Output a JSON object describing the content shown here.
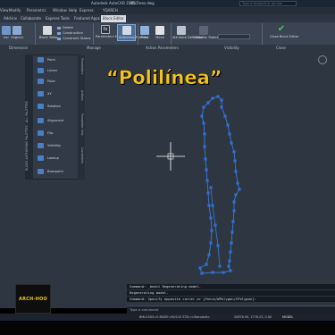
{
  "titlebar": {
    "app_title": "Autodesk AutoCAD 2025",
    "file_name": "MisTrees.dwg",
    "search_placeholder": "Type a keyword or phrase"
  },
  "menus": [
    "View",
    "Modify",
    "Parametric",
    "Window",
    "Help",
    "Express",
    "YQARCH"
  ],
  "tabs": [
    {
      "label": "Add-ins",
      "active": false
    },
    {
      "label": "Collaborate",
      "active": false
    },
    {
      "label": "Express Tools",
      "active": false
    },
    {
      "label": "Featured Apps",
      "active": false
    },
    {
      "label": "Block Editor",
      "active": true
    }
  ],
  "ribbon": {
    "dimension": {
      "btn1": "ear",
      "btn2": "Aligned"
    },
    "block_table": "Block Table",
    "delete": "Delete",
    "construction": "Construction",
    "constraint_status": "Constraint Status",
    "parameters_manager": "Parameters Manager",
    "authoring_palettes": "Authoring Palettes",
    "point": "Point",
    "move": "Move",
    "attribute_definition": "Attribute Definition",
    "visibility_states": "Visibility States",
    "visibility_box": "",
    "close_block_editor": "Close Block Editor"
  },
  "ribbon_panels": {
    "dimension": "Dimension",
    "manage": "Manage",
    "action_parameters": "Action Parameters",
    "visibility": "Visibility",
    "close": "Close"
  },
  "palette": {
    "title": "BLOCK AUTHORING PALETTES - ALL PALETTES",
    "tabs": [
      "Parameters",
      "Actions",
      "Parameter Sets",
      "Constraints"
    ],
    "items": [
      "Point",
      "Linear",
      "Polar",
      "XY",
      "Rotation",
      "Alignment",
      "Flip",
      "Visibility",
      "Lookup",
      "Basepoint"
    ]
  },
  "caption": "“Polilínea”",
  "figure": {
    "stroke_color": "#3e7bd6",
    "grip_color": "#2f6fd8"
  },
  "command": {
    "history": [
      "Command: _bedit Regenerating model.",
      "Regenerating model.",
      "Command: Specify opposite corner or [Fence/WPolygon/CPolygon]:"
    ],
    "prompt": "Type a command"
  },
  "logo_text": "ARCH-HOO",
  "status": {
    "left": "BMLOCKS=0  BSIZE=90/110  STD=<Standard>",
    "coords": "20876.90, 1778.23, 0.00",
    "mode": "MODEL"
  }
}
